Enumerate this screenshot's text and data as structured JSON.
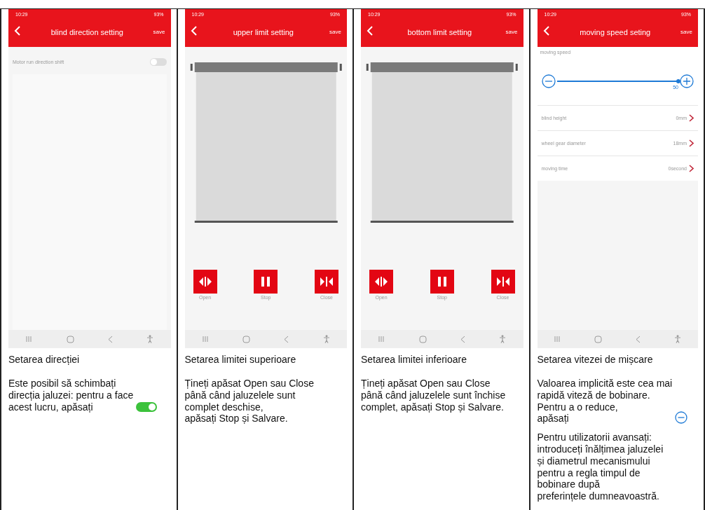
{
  "columns": [
    {
      "screen": {
        "kind": "toggle",
        "time": "10:29",
        "battery": "93%",
        "title": "blind direction setting",
        "action": "save",
        "toggle": {
          "label": "Motor run direction shift",
          "on": false
        }
      },
      "caption": {
        "heading": "Setarea direcției",
        "paragraphs": [
          {
            "lines": [
              "Este posibil să schimbați",
              "direcția jaluzei: pentru a face",
              "acest lucru, apăsați"
            ],
            "kind": "toggle_hint"
          }
        ]
      }
    },
    {
      "screen": {
        "kind": "limit",
        "time": "10:29",
        "battery": "93%",
        "title": "upper limit setting",
        "action": "save",
        "buttons": [
          {
            "kind": "open",
            "label": "Open"
          },
          {
            "kind": "stop",
            "label": "Stop"
          },
          {
            "kind": "close",
            "label": "Close"
          }
        ]
      },
      "caption": {
        "heading": "Setarea limitei superioare",
        "paragraphs": [
          {
            "lines": [
              "Țineți apăsat Open sau Close",
              "până când jaluzelele sunt",
              "complet deschise,",
              "apăsați Stop și Salvare."
            ]
          }
        ]
      }
    },
    {
      "screen": {
        "kind": "limit",
        "time": "10:29",
        "battery": "93%",
        "title": "bottom limit setting",
        "action": "save",
        "buttons": [
          {
            "kind": "open",
            "label": "Open"
          },
          {
            "kind": "stop",
            "label": "Stop"
          },
          {
            "kind": "close",
            "label": "Close"
          }
        ]
      },
      "caption": {
        "heading": "Setarea limitei inferioare",
        "paragraphs": [
          {
            "lines": [
              "Țineți apăsat Open sau Close",
              "până când jaluzelele sunt închise",
              "complet, apăsați Stop și Salvare."
            ]
          }
        ]
      }
    },
    {
      "screen": {
        "kind": "speed",
        "time": "10:29",
        "battery": "93%",
        "title": "moving speed seting",
        "action": "save",
        "speed_label": "moving speed",
        "slider": {
          "level": 1,
          "reading": "50"
        },
        "rows": [
          {
            "label": "blind height",
            "value": "0mm"
          },
          {
            "label": "wheel gear diameter",
            "value": "18mm"
          },
          {
            "label": "moving time",
            "value": "0second"
          }
        ]
      },
      "caption": {
        "heading": "Setarea vitezei de mișcare",
        "paragraphs": [
          {
            "lines": [
              "Valoarea implicită este cea mai",
              "rapidă viteză de bobinare.",
              "Pentru a o reduce,",
              "apăsați"
            ],
            "kind": "minus_hint"
          },
          {
            "lines": [
              "Pentru utilizatorii avansați:",
              "introduceți înălțimea jaluzelei",
              "și diametrul mecanismului",
              "pentru a regla timpul de",
              "bobinare după",
              "preferințele dumneavoastră."
            ]
          }
        ]
      }
    }
  ]
}
